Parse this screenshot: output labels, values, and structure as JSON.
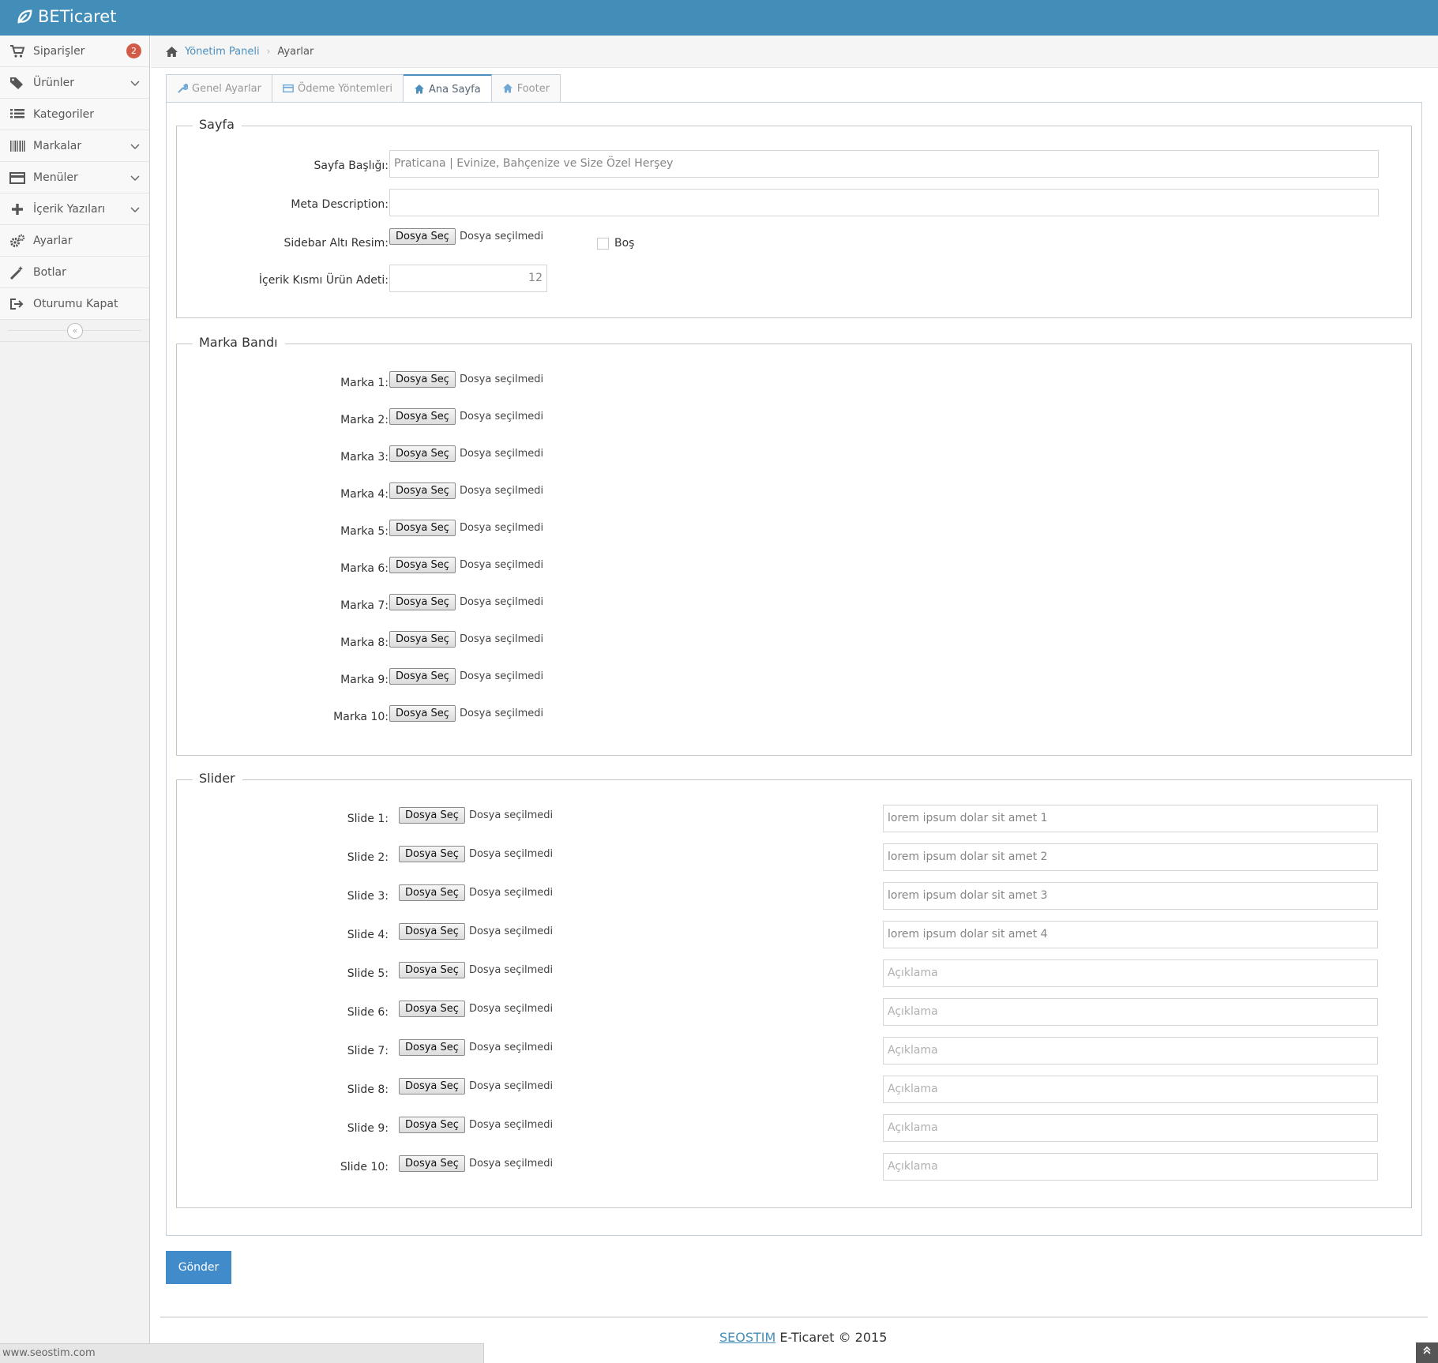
{
  "app": {
    "brand": "BETicaret"
  },
  "sidebar": {
    "items": [
      {
        "label": "Siparişler",
        "icon": "shopping-cart-icon",
        "badge": "2"
      },
      {
        "label": "Ürünler",
        "icon": "tags-icon",
        "has_submenu": true
      },
      {
        "label": "Kategoriler",
        "icon": "list-icon"
      },
      {
        "label": "Markalar",
        "icon": "barcode-icon",
        "has_submenu": true
      },
      {
        "label": "Menüler",
        "icon": "credit-card-icon",
        "has_submenu": true
      },
      {
        "label": "İçerik Yazıları",
        "icon": "plus-icon",
        "has_submenu": true
      },
      {
        "label": "Ayarlar",
        "icon": "cogs-icon"
      },
      {
        "label": "Botlar",
        "icon": "magic-wand-icon"
      },
      {
        "label": "Oturumu Kapat",
        "icon": "sign-out-icon"
      }
    ],
    "collapse_symbol": "«"
  },
  "breadcrumb": {
    "home": "Yönetim Paneli",
    "current": "Ayarlar"
  },
  "tabs": [
    {
      "label": "Genel Ayarlar",
      "icon": "wrench-icon",
      "active": false
    },
    {
      "label": "Ödeme Yöntemleri",
      "icon": "credit-card-icon",
      "active": false
    },
    {
      "label": "Ana Sayfa",
      "icon": "home-icon",
      "active": true
    },
    {
      "label": "Footer",
      "icon": "home-icon",
      "active": false
    }
  ],
  "file_button_label": "Dosya Seç",
  "file_status": "Dosya seçilmedi",
  "sayfa": {
    "legend": "Sayfa",
    "title_label": "Sayfa Başlığı:",
    "title_value": "Praticana | Evinize, Bahçenize ve Size Özel Herşey",
    "meta_label": "Meta Description:",
    "meta_value": "",
    "sidebar_image_label": "Sidebar Altı Resim:",
    "empty_checkbox_label": "Boş",
    "product_count_label": "İçerik Kısmı Ürün Adeti:",
    "product_count_value": "12"
  },
  "marka_bandi": {
    "legend": "Marka Bandı",
    "items": [
      "Marka 1:",
      "Marka 2:",
      "Marka 3:",
      "Marka 4:",
      "Marka 5:",
      "Marka 6:",
      "Marka 7:",
      "Marka 8:",
      "Marka 9:",
      "Marka 10:"
    ]
  },
  "slider": {
    "legend": "Slider",
    "items": [
      {
        "label": "Slide 1:",
        "text": "lorem ipsum dolar sit amet 1"
      },
      {
        "label": "Slide 2:",
        "text": "lorem ipsum dolar sit amet 2"
      },
      {
        "label": "Slide 3:",
        "text": "lorem ipsum dolar sit amet 3"
      },
      {
        "label": "Slide 4:",
        "text": "lorem ipsum dolar sit amet 4"
      },
      {
        "label": "Slide 5:",
        "text": ""
      },
      {
        "label": "Slide 6:",
        "text": ""
      },
      {
        "label": "Slide 7:",
        "text": ""
      },
      {
        "label": "Slide 8:",
        "text": ""
      },
      {
        "label": "Slide 9:",
        "text": ""
      },
      {
        "label": "Slide 10:",
        "text": ""
      }
    ],
    "placeholder": "Açıklama"
  },
  "submit_label": "Gönder",
  "footer": {
    "company": "SEOSTIM",
    "text": " E-Ticaret © 2015"
  },
  "status_bar_url": "www.seostim.com",
  "scroll_top_symbol": "»",
  "colors": {
    "navbar": "#438eb9",
    "badge": "#d15b47",
    "submit": "#428bca",
    "link": "#4c8fbd"
  }
}
